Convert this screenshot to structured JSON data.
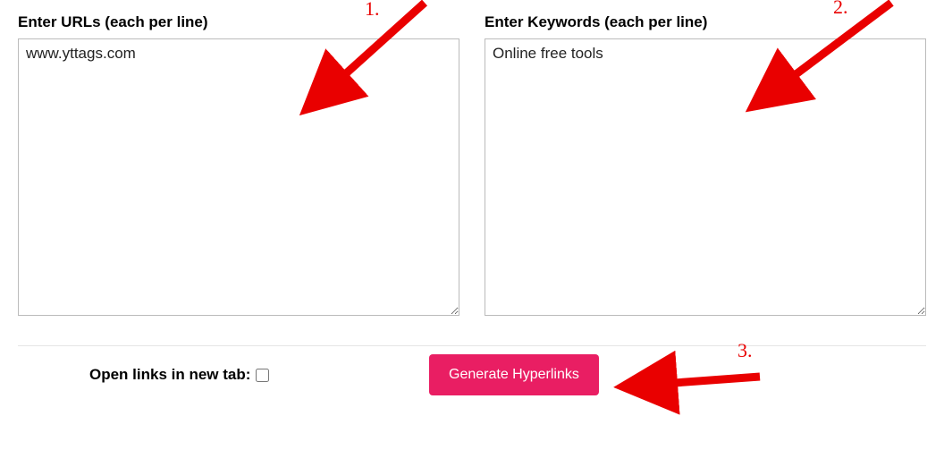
{
  "urls": {
    "label": "Enter URLs (each per line)",
    "value": "www.yttags.com"
  },
  "keywords": {
    "label": "Enter Keywords (each per line)",
    "value": "Online free tools"
  },
  "options": {
    "open_new_tab_label": "Open links in new tab:",
    "open_new_tab_checked": false
  },
  "actions": {
    "generate_label": "Generate Hyperlinks"
  },
  "annotations": {
    "step1": "1.",
    "step2": "2.",
    "step3": "3."
  }
}
